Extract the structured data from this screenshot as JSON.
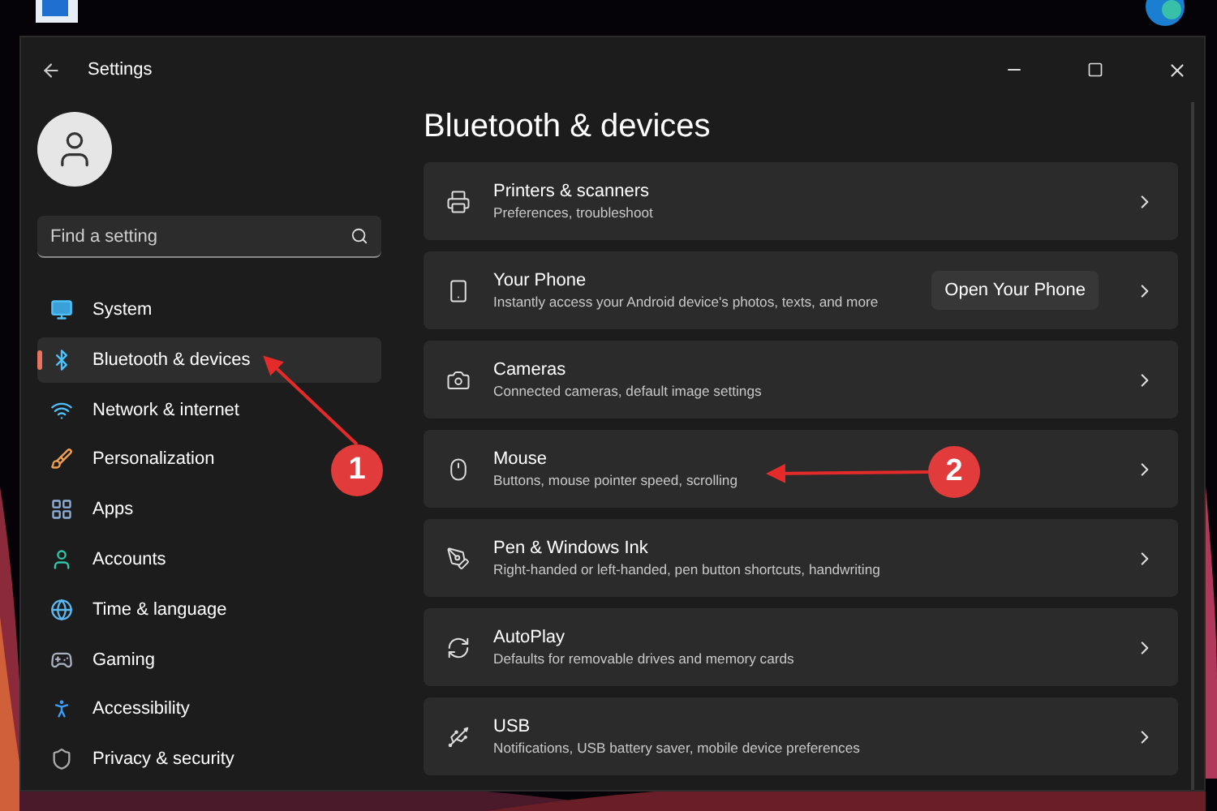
{
  "window": {
    "title": "Settings"
  },
  "search": {
    "placeholder": "Find a setting"
  },
  "sidebar": {
    "items": [
      {
        "label": "System",
        "selected": false
      },
      {
        "label": "Bluetooth & devices",
        "selected": true
      },
      {
        "label": "Network & internet",
        "selected": false
      },
      {
        "label": "Personalization",
        "selected": false
      },
      {
        "label": "Apps",
        "selected": false
      },
      {
        "label": "Accounts",
        "selected": false
      },
      {
        "label": "Time & language",
        "selected": false
      },
      {
        "label": "Gaming",
        "selected": false
      },
      {
        "label": "Accessibility",
        "selected": false
      },
      {
        "label": "Privacy & security",
        "selected": false
      }
    ]
  },
  "page": {
    "title": "Bluetooth & devices",
    "cards": [
      {
        "title": "Printers & scanners",
        "subtitle": "Preferences, troubleshoot"
      },
      {
        "title": "Your Phone",
        "subtitle": "Instantly access your Android device's photos, texts, and more",
        "button": "Open Your Phone"
      },
      {
        "title": "Cameras",
        "subtitle": "Connected cameras, default image settings"
      },
      {
        "title": "Mouse",
        "subtitle": "Buttons, mouse pointer speed, scrolling"
      },
      {
        "title": "Pen & Windows Ink",
        "subtitle": "Right-handed or left-handed, pen button shortcuts, handwriting"
      },
      {
        "title": "AutoPlay",
        "subtitle": "Defaults for removable drives and memory cards"
      },
      {
        "title": "USB",
        "subtitle": "Notifications, USB battery saver, mobile device preferences"
      }
    ]
  },
  "annotations": [
    {
      "label": "1"
    },
    {
      "label": "2"
    }
  ]
}
